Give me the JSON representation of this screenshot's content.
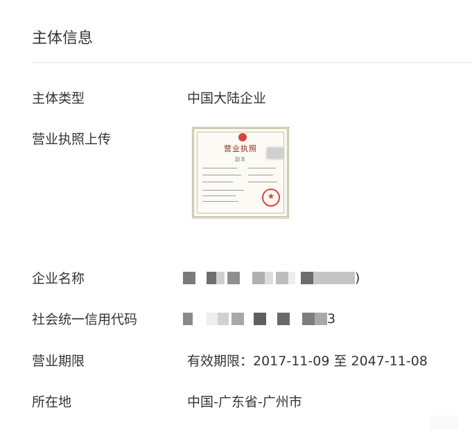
{
  "section": {
    "title": "主体信息"
  },
  "fields": {
    "subject_type": {
      "label": "主体类型",
      "value": "中国大陆企业"
    },
    "license_upload": {
      "label": "营业执照上传",
      "image_title": "营业执照",
      "image_subtitle": "副本"
    },
    "company_name": {
      "label": "企业名称",
      "value_tail": ")"
    },
    "credit_code": {
      "label": "社会统一信用代码",
      "value_tail": "3"
    },
    "business_term": {
      "label": "营业期限",
      "value": "有效期限：2017-11-09 至 2047-11-08"
    },
    "location": {
      "label": "所在地",
      "value": "中国-广东省-广州市"
    }
  },
  "colors": {
    "text": "#333333",
    "divider": "#e6e6e6",
    "seal_red": "#d7463b"
  }
}
